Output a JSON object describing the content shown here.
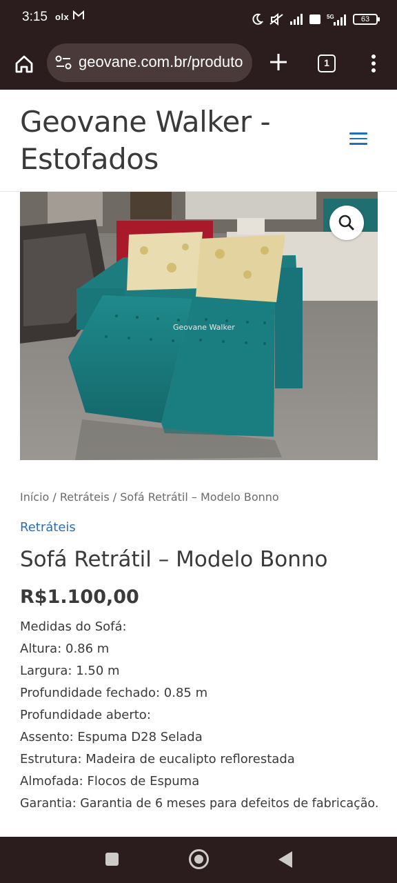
{
  "status_bar": {
    "time": "3:15",
    "app_badges": "olx",
    "mail_icon": "gmail-icon",
    "icons": [
      "moon-icon",
      "mute-icon",
      "signal-icon",
      "volte-icon",
      "5g-signal-icon"
    ],
    "battery": "63"
  },
  "browser": {
    "home_icon": "home-icon",
    "url": "geovane.com.br/produto",
    "site_settings_icon": "tune-icon",
    "new_tab_icon": "plus-icon",
    "tab_count": "1",
    "menu_icon": "more-vertical-icon"
  },
  "site": {
    "title_line1": "Geovane Walker -",
    "title_line2": "Estofados",
    "menu_icon": "hamburger-menu-icon",
    "accent": "#1e6fc1"
  },
  "product": {
    "image_alt": "Sofá Retrátil – Modelo Bonno",
    "watermark": "Geovane Walker",
    "zoom_icon": "magnifier-icon",
    "breadcrumb": {
      "home": "Início",
      "separator": " / ",
      "category": "Retráteis",
      "current": "Sofá Retrátil – Modelo Bonno"
    },
    "category_link": "Retráteis",
    "title": "Sofá Retrátil – Modelo Bonno",
    "price": "R$1.100,00",
    "description": [
      "Medidas do Sofá:",
      "Altura: 0.86 m",
      "Largura: 1.50 m",
      "Profundidade fechado: 0.85 m",
      "Profundidade aberto:",
      "Assento: Espuma D28 Selada",
      "Estrutura: Madeira de eucalipto reflorestada",
      "Almofada: Flocos de Espuma",
      "Garantia: Garantia de 6 meses para defeitos de fabricação."
    ]
  },
  "nav_bar": {
    "recents_icon": "recents-square-icon",
    "home_icon": "home-circle-icon",
    "back_icon": "back-triangle-icon"
  }
}
